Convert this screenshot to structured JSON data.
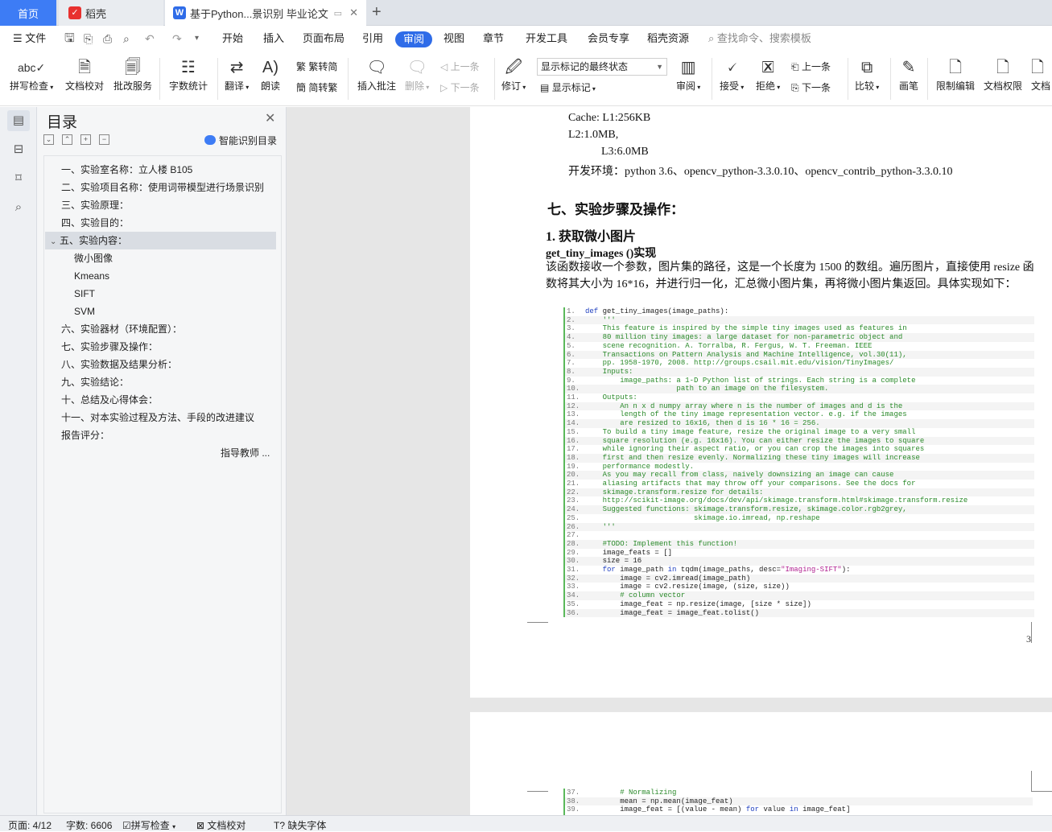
{
  "tabs": {
    "home": "首页",
    "daoke": "稻壳",
    "doc": "基于Python...景识别 毕业论文"
  },
  "menu": {
    "file": "文件",
    "start": "开始",
    "insert": "插入",
    "layout": "页面布局",
    "ref": "引用",
    "review": "审阅",
    "view": "视图",
    "chapter": "章节",
    "dev": "开发工具",
    "member": "会员专享",
    "daoke": "稻壳资源",
    "search": "查找命令、搜索模板"
  },
  "ribbon": {
    "spell": "拼写检查",
    "doccheck": "文档校对",
    "batch": "批改服务",
    "wordcount": "字数统计",
    "translate": "翻译",
    "read": "朗读",
    "t2s": "繁转简",
    "s2t": "简转繁",
    "insertcomment": "插入批注",
    "delete": "删除",
    "prev": "上一条",
    "next": "下一条",
    "track": "修订",
    "display_state": "显示标记的最终状态",
    "show_marks": "显示标记",
    "review_pane": "审阅",
    "accept": "接受",
    "reject": "拒绝",
    "prev2": "上一条",
    "next2": "下一条",
    "compare": "比较",
    "pen": "画笔",
    "restrict": "限制编辑",
    "perm": "文档权限",
    "more": "文档"
  },
  "toc": {
    "title": "目录",
    "smart": "智能识别目录",
    "items": [
      "一、实验室名称：立人楼 B105",
      "二、实验项目名称：使用词带模型进行场景识别",
      "三、实验原理：",
      "四、实验目的：",
      "五、实验内容：",
      "微小图像",
      "Kmeans",
      "SIFT",
      "SVM",
      "六、实验器材（环境配置）：",
      "七、实验步骤及操作：",
      "八、实验数据及结果分析：",
      "九、实验结论：",
      "十、总结及心得体会：",
      "十一、对本实验过程及方法、手段的改进建议",
      "报告评分：",
      "指导教师 ..."
    ]
  },
  "doc": {
    "cache1": "Cache: L1:256KB",
    "cache2": "L2:1.0MB,",
    "cache3": "L3:6.0MB",
    "env": "开发环境：python 3.6、opencv_python-3.3.0.10、opencv_contrib_python-3.3.0.10",
    "h_steps": "七、实验步骤及操作：",
    "h_tiny": "1.  获取微小图片",
    "func": "get_tiny_images ()实现",
    "para": "该函数接收一个参数，图片集的路径，这是一个长度为 1500 的数组。遍历图片，直接使用 resize 函数将其大小为 16*16，并进行归一化，汇总微小图片集，再将微小图片集返回。具体实现如下：",
    "page_num": "3"
  },
  "code": [
    {
      "n": "1.",
      "t": "def get_tiny_images(image_paths):"
    },
    {
      "n": "2.",
      "t": "    '''"
    },
    {
      "n": "3.",
      "t": "    This feature is inspired by the simple tiny images used as features in"
    },
    {
      "n": "4.",
      "t": "    80 million tiny images: a large dataset for non-parametric object and"
    },
    {
      "n": "5.",
      "t": "    scene recognition. A. Torralba, R. Fergus, W. T. Freeman. IEEE"
    },
    {
      "n": "6.",
      "t": "    Transactions on Pattern Analysis and Machine Intelligence, vol.30(11),"
    },
    {
      "n": "7.",
      "t": "    pp. 1958-1970, 2008. http://groups.csail.mit.edu/vision/TinyImages/"
    },
    {
      "n": "8.",
      "t": "    Inputs:"
    },
    {
      "n": "9.",
      "t": "        image_paths: a 1-D Python list of strings. Each string is a complete"
    },
    {
      "n": "10.",
      "t": "                     path to an image on the filesystem."
    },
    {
      "n": "11.",
      "t": "    Outputs:"
    },
    {
      "n": "12.",
      "t": "        An n x d numpy array where n is the number of images and d is the"
    },
    {
      "n": "13.",
      "t": "        length of the tiny image representation vector. e.g. if the images"
    },
    {
      "n": "14.",
      "t": "        are resized to 16x16, then d is 16 * 16 = 256."
    },
    {
      "n": "15.",
      "t": "    To build a tiny image feature, resize the original image to a very small"
    },
    {
      "n": "16.",
      "t": "    square resolution (e.g. 16x16). You can either resize the images to square"
    },
    {
      "n": "17.",
      "t": "    while ignoring their aspect ratio, or you can crop the images into squares"
    },
    {
      "n": "18.",
      "t": "    first and then resize evenly. Normalizing these tiny images will increase"
    },
    {
      "n": "19.",
      "t": "    performance modestly."
    },
    {
      "n": "20.",
      "t": "    As you may recall from class, naively downsizing an image can cause"
    },
    {
      "n": "21.",
      "t": "    aliasing artifacts that may throw off your comparisons. See the docs for"
    },
    {
      "n": "22.",
      "t": "    skimage.transform.resize for details:"
    },
    {
      "n": "23.",
      "t": "    http://scikit-image.org/docs/dev/api/skimage.transform.html#skimage.transform.resize"
    },
    {
      "n": "24.",
      "t": "    Suggested functions: skimage.transform.resize, skimage.color.rgb2grey,"
    },
    {
      "n": "25.",
      "t": "                         skimage.io.imread, np.reshape"
    },
    {
      "n": "26.",
      "t": "    '''"
    },
    {
      "n": "27.",
      "t": ""
    },
    {
      "n": "28.",
      "t": "    #TODO: Implement this function!"
    },
    {
      "n": "29.",
      "t": "    image_feats = []"
    },
    {
      "n": "30.",
      "t": "    size = 16"
    },
    {
      "n": "31.",
      "t": "    for image_path in tqdm(image_paths, desc=\"Imaging-SIFT\"):"
    },
    {
      "n": "32.",
      "t": "        image = cv2.imread(image_path)"
    },
    {
      "n": "33.",
      "t": "        image = cv2.resize(image, (size, size))"
    },
    {
      "n": "34.",
      "t": "        # column vector"
    },
    {
      "n": "35.",
      "t": "        image_feat = np.resize(image, [size * size])"
    },
    {
      "n": "36.",
      "t": "        image_feat = image_feat.tolist()"
    }
  ],
  "code2": [
    {
      "n": "37.",
      "t": "        # Normalizing"
    },
    {
      "n": "38.",
      "t": "        mean = np.mean(image_feat)"
    },
    {
      "n": "39.",
      "t": "        image_feat = [(value - mean) for value in image_feat]"
    }
  ],
  "status": {
    "page": "页面: 4/12",
    "words": "字数: 6606",
    "spell": "拼写检查",
    "doccheck": "文档校对",
    "font": "缺失字体"
  }
}
